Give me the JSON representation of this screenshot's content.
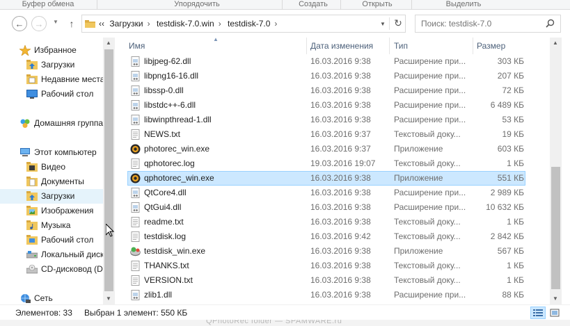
{
  "ribbon": {
    "groups": [
      "Буфер обмена",
      "Упорядочить",
      "Создать",
      "Открыть",
      "Выделить"
    ]
  },
  "toolbar": {
    "back_label": "←",
    "forward_label": "→",
    "up_label": "↑",
    "refresh_label": "↻"
  },
  "address": {
    "overflow": "‹‹",
    "crumbs": [
      "Загрузки",
      "testdisk-7.0.win",
      "testdisk-7.0"
    ],
    "separator": "›"
  },
  "search": {
    "placeholder": "Поиск: testdisk-7.0"
  },
  "navigation": {
    "favorites": {
      "label": "Избранное",
      "icon": "star-icon"
    },
    "favorites_items": [
      {
        "label": "Загрузки",
        "icon": "downloads-folder-icon"
      },
      {
        "label": "Недавние места",
        "icon": "recent-places-icon"
      },
      {
        "label": "Рабочий стол",
        "icon": "desktop-icon"
      }
    ],
    "homegroup": {
      "label": "Домашняя группа",
      "icon": "homegroup-icon"
    },
    "computer": {
      "label": "Этот компьютер",
      "icon": "computer-icon"
    },
    "computer_items": [
      {
        "label": "Видео",
        "icon": "videos-folder-icon",
        "selected": false
      },
      {
        "label": "Документы",
        "icon": "documents-folder-icon",
        "selected": false
      },
      {
        "label": "Загрузки",
        "icon": "downloads-folder-icon",
        "selected": true
      },
      {
        "label": "Изображения",
        "icon": "pictures-folder-icon",
        "selected": false
      },
      {
        "label": "Музыка",
        "icon": "music-folder-icon",
        "selected": false
      },
      {
        "label": "Рабочий стол",
        "icon": "desktop-folder-icon",
        "selected": false
      },
      {
        "label": "Локальный диск",
        "icon": "local-disk-icon",
        "selected": false
      },
      {
        "label": "CD-дисковод (D:",
        "icon": "cd-drive-icon",
        "selected": false
      }
    ],
    "network": {
      "label": "Сеть",
      "icon": "network-icon"
    }
  },
  "columns": {
    "name": "Имя",
    "date": "Дата изменения",
    "type": "Тип",
    "size": "Размер"
  },
  "files": [
    {
      "name": "libjpeg-62.dll",
      "date": "16.03.2016 9:38",
      "type": "Расширение при...",
      "size": "303 КБ",
      "icon": "dll-icon",
      "selected": false
    },
    {
      "name": "libpng16-16.dll",
      "date": "16.03.2016 9:38",
      "type": "Расширение при...",
      "size": "207 КБ",
      "icon": "dll-icon",
      "selected": false
    },
    {
      "name": "libssp-0.dll",
      "date": "16.03.2016 9:38",
      "type": "Расширение при...",
      "size": "72 КБ",
      "icon": "dll-icon",
      "selected": false
    },
    {
      "name": "libstdc++-6.dll",
      "date": "16.03.2016 9:38",
      "type": "Расширение при...",
      "size": "6 489 КБ",
      "icon": "dll-icon",
      "selected": false
    },
    {
      "name": "libwinpthread-1.dll",
      "date": "16.03.2016 9:38",
      "type": "Расширение при...",
      "size": "53 КБ",
      "icon": "dll-icon",
      "selected": false
    },
    {
      "name": "NEWS.txt",
      "date": "16.03.2016 9:37",
      "type": "Текстовый доку...",
      "size": "19 КБ",
      "icon": "text-file-icon",
      "selected": false
    },
    {
      "name": "photorec_win.exe",
      "date": "16.03.2016 9:37",
      "type": "Приложение",
      "size": "603 КБ",
      "icon": "photorec-app-icon",
      "selected": false
    },
    {
      "name": "qphotorec.log",
      "date": "19.03.2016 19:07",
      "type": "Текстовый доку...",
      "size": "1 КБ",
      "icon": "text-file-icon",
      "selected": false
    },
    {
      "name": "qphotorec_win.exe",
      "date": "16.03.2016 9:38",
      "type": "Приложение",
      "size": "551 КБ",
      "icon": "photorec-app-icon",
      "selected": true
    },
    {
      "name": "QtCore4.dll",
      "date": "16.03.2016 9:38",
      "type": "Расширение при...",
      "size": "2 989 КБ",
      "icon": "dll-icon",
      "selected": false
    },
    {
      "name": "QtGui4.dll",
      "date": "16.03.2016 9:38",
      "type": "Расширение при...",
      "size": "10 632 КБ",
      "icon": "dll-icon",
      "selected": false
    },
    {
      "name": "readme.txt",
      "date": "16.03.2016 9:38",
      "type": "Текстовый доку...",
      "size": "1 КБ",
      "icon": "text-file-icon",
      "selected": false
    },
    {
      "name": "testdisk.log",
      "date": "16.03.2016 9:42",
      "type": "Текстовый доку...",
      "size": "2 842 КБ",
      "icon": "text-file-icon",
      "selected": false
    },
    {
      "name": "testdisk_win.exe",
      "date": "16.03.2016 9:38",
      "type": "Приложение",
      "size": "567 КБ",
      "icon": "testdisk-app-icon",
      "selected": false
    },
    {
      "name": "THANKS.txt",
      "date": "16.03.2016 9:38",
      "type": "Текстовый доку...",
      "size": "1 КБ",
      "icon": "text-file-icon",
      "selected": false
    },
    {
      "name": "VERSION.txt",
      "date": "16.03.2016 9:38",
      "type": "Текстовый доку...",
      "size": "1 КБ",
      "icon": "text-file-icon",
      "selected": false
    },
    {
      "name": "zlib1.dll",
      "date": "16.03.2016 9:38",
      "type": "Расширение при...",
      "size": "88 КБ",
      "icon": "dll-icon",
      "selected": false
    }
  ],
  "status": {
    "count": "Элементов: 33",
    "selection": "Выбран 1 элемент: 550 КБ"
  },
  "watermark": "QPhotoRec folder — SPAMWARE.ru",
  "colors": {
    "selection_bg": "#cce8ff",
    "selection_border": "#99d1ff",
    "header_text": "#4c607a",
    "secondary_text": "#6d6d6d"
  }
}
